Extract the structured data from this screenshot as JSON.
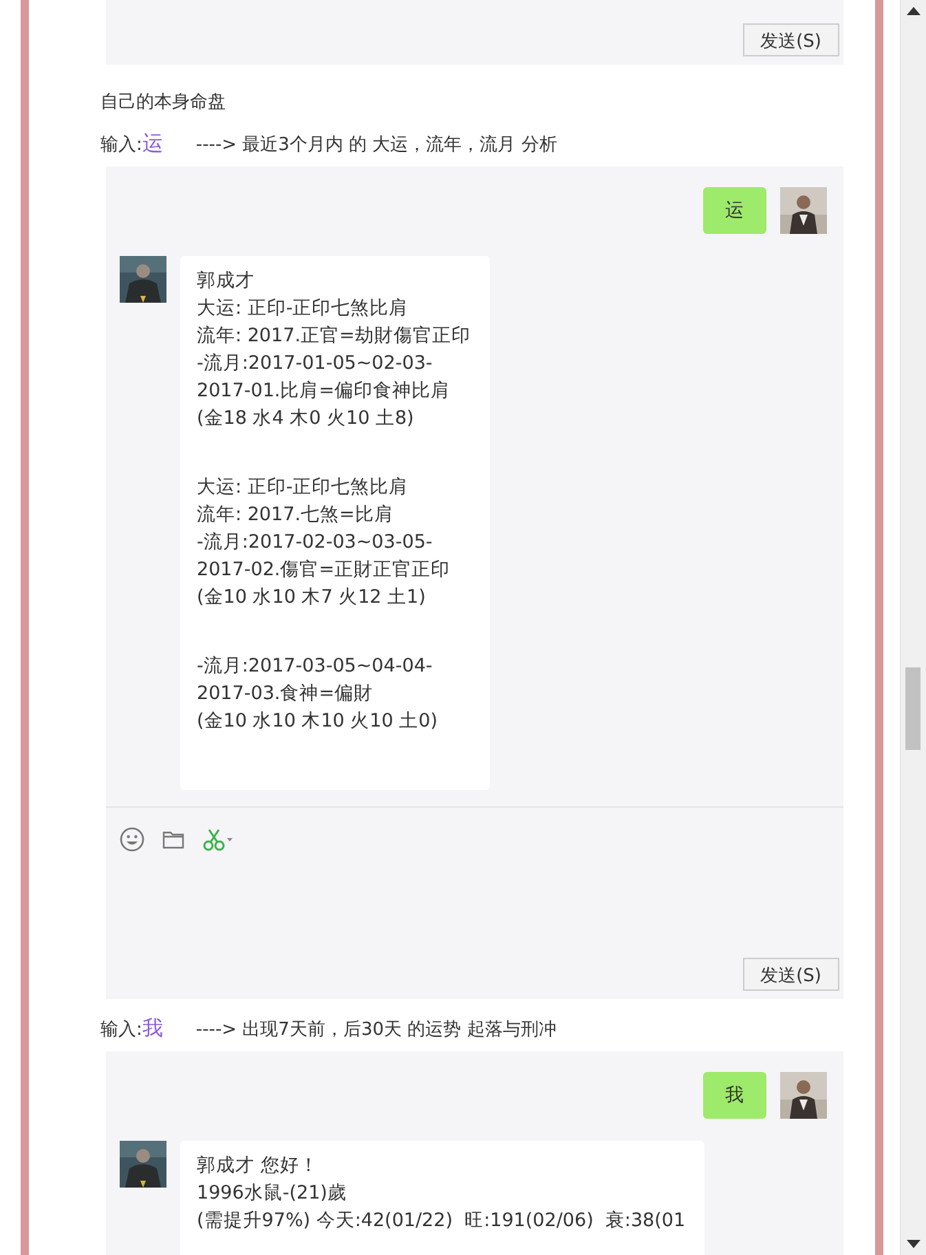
{
  "top_panel": {
    "send_button": "发送(S)"
  },
  "caption": "自己的本身命盘",
  "sections": [
    {
      "prompt": {
        "label": "输入:",
        "keyword": "运",
        "description": "----> 最近3个月内 的 大运，流年，流月 分析"
      },
      "chat": {
        "sent": "运",
        "reply_blocks": [
          [
            "郭成才",
            "大运: 正印-正印七煞比肩",
            "流年: 2017.正官=劫財傷官正印",
            "-流月:2017-01-05~02-03-",
            "2017-01.比肩=偏印食神比肩",
            "(金18 水4 木0 火10 土8)"
          ],
          [
            "大运: 正印-正印七煞比肩",
            "流年: 2017.七煞=比肩",
            "-流月:2017-02-03~03-05-",
            "2017-02.傷官=正財正官正印",
            "(金10 水10 木7 火12 土1)"
          ],
          [
            "-流月:2017-03-05~04-04-",
            "2017-03.食神=偏財",
            "(金10 水10 木10 火10 土0)"
          ]
        ],
        "send_button": "发送(S)"
      }
    },
    {
      "prompt": {
        "label": "输入:",
        "keyword": "我",
        "description": "----> 出现7天前，后30天 的运势 起落与刑冲"
      },
      "chat": {
        "sent": "我",
        "reply_blocks": [
          [
            "郭成才 您好！",
            "1996水鼠-(21)歲",
            "(需提升97%) 今天:42(01/22)  旺:191(02/06)  衰:38(01"
          ]
        ]
      }
    }
  ]
}
